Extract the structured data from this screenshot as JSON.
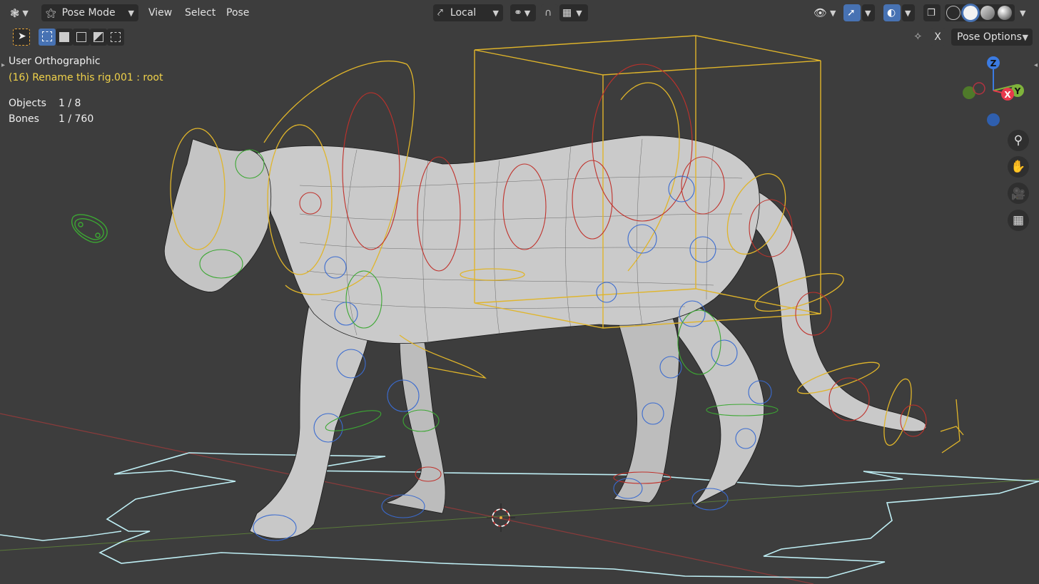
{
  "header": {
    "editor_type_icon": "viewport-editor-icon",
    "mode": {
      "label": "Pose Mode",
      "icon": "pose-mode-icon"
    },
    "menus": [
      "View",
      "Select",
      "Pose"
    ],
    "transform_orientation": {
      "label": "Local",
      "icon": "local-orientation-icon"
    },
    "pivot_icon": "pivot-point-icon",
    "snap_icon": "snap-magnet-icon",
    "snap_target_icon": "snap-grid-icon",
    "visibility_icon": "eye-icon",
    "gizmo_icon": "gizmo-arrow-icon",
    "overlay_icon": "overlay-icon",
    "xray_icon": "xray-icon",
    "shading_modes": [
      "wireframe",
      "solid",
      "material",
      "rendered"
    ],
    "active_shading": "solid"
  },
  "toolbar2": {
    "select_tool_icon": "select-cursor-icon",
    "selection_modes": [
      "new-selection",
      "extend-selection",
      "subtract-selection",
      "invert-selection",
      "intersect-selection"
    ],
    "x_mirror_label": "X",
    "pose_options_label": "Pose Options"
  },
  "overlay": {
    "view_name": "User Orthographic",
    "active_info": "(16) Rename this rig.001 : root",
    "stats": [
      {
        "label": "Objects",
        "value": "1 / 8"
      },
      {
        "label": "Bones",
        "value": "1 / 760"
      }
    ]
  },
  "nav_gizmo": {
    "axes": [
      "Z",
      "Y",
      "X"
    ],
    "colors": {
      "x": "#e8394c",
      "y": "#7fb33b",
      "z": "#3b7be2"
    }
  },
  "nav_buttons": [
    "zoom-icon",
    "hand-pan-icon",
    "camera-icon",
    "grid-ortho-icon"
  ],
  "colors": {
    "viewport_bg": "#3d3d3d",
    "header_bg": "#2b2b2b",
    "active_text": "#f0d24a",
    "bone_yellow": "#e0b52a",
    "bone_red": "#c0312b",
    "bone_blue": "#3a6bd0",
    "bone_green": "#3ca833",
    "root_cyan": "#bfeff5"
  }
}
